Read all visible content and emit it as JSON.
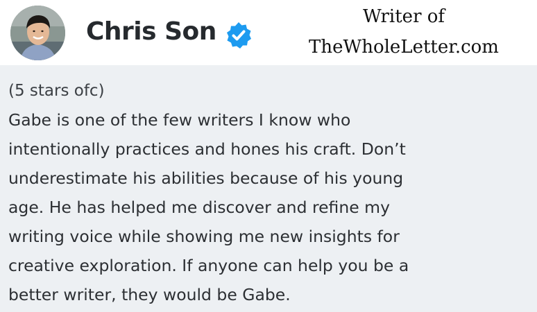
{
  "author": {
    "name": "Chris Son",
    "verified": true,
    "verified_color": "#1d9bf0",
    "avatar_icon": "profile-photo"
  },
  "caption": {
    "line1": "Writer of",
    "line2": "TheWholeLetter.com"
  },
  "review": {
    "rating_note": "(5 stars ofc)",
    "lines": [
      "Gabe is one of the few writers I know who",
      "intentionally practices and hones his craft. Don’t",
      "underestimate his abilities because of his young",
      "age. He has helped me discover and refine my",
      "writing voice while showing me new insights for",
      "creative exploration. If anyone can help you be a",
      "better writer, they would be Gabe."
    ]
  },
  "colors": {
    "review_background": "#edf0f3",
    "text": "#2c2f33"
  }
}
